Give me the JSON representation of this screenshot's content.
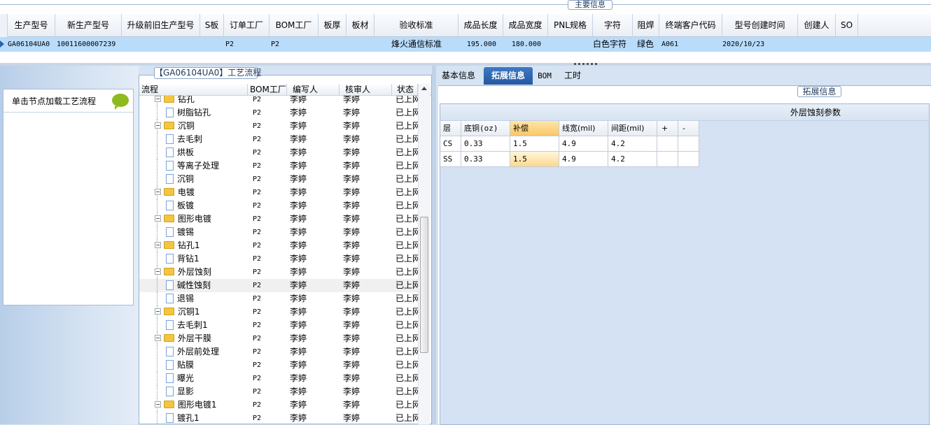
{
  "main_info": {
    "legend": "主要信息",
    "columns": [
      "生产型号",
      "新生产型号",
      "升级前旧生产型号",
      "S板",
      "订单工厂",
      "BOM工厂",
      "板厚",
      "板材",
      "验收标准",
      "成品长度",
      "成品宽度",
      "PNL规格",
      "字符",
      "阻焊",
      "终端客户代码",
      "型号创建时间",
      "创建人",
      "SO"
    ],
    "row": {
      "prod_model": "GA06104UA0",
      "new_prod_model": "10011600007239",
      "order_factory": "P2",
      "bom_factory": "P2",
      "acceptance": "烽火通信标准",
      "length": "195.000",
      "width": "180.000",
      "char": "白色字符",
      "solder": "绿色",
      "customer_code": "A061",
      "created": "2020/10/23"
    }
  },
  "left_panel": {
    "hint": "单击节点加载工艺流程"
  },
  "flow": {
    "title": "【GA06104UA0】工艺流程",
    "columns": [
      "流程",
      "BOM工厂",
      "编写人",
      "核审人",
      "状态"
    ],
    "rows": [
      {
        "name": "钻孔",
        "level": 0,
        "folder": true,
        "bom": "P2",
        "writer": "李婷",
        "reviewer": "李婷",
        "status": "已上网"
      },
      {
        "name": "树脂钻孔",
        "level": 1,
        "folder": false,
        "bom": "P2",
        "writer": "李婷",
        "reviewer": "李婷",
        "status": "已上网"
      },
      {
        "name": "沉铜",
        "level": 0,
        "folder": true,
        "bom": "P2",
        "writer": "李婷",
        "reviewer": "李婷",
        "status": "已上网"
      },
      {
        "name": "去毛刺",
        "level": 1,
        "folder": false,
        "bom": "P2",
        "writer": "李婷",
        "reviewer": "李婷",
        "status": "已上网"
      },
      {
        "name": "烘板",
        "level": 1,
        "folder": false,
        "bom": "P2",
        "writer": "李婷",
        "reviewer": "李婷",
        "status": "已上网"
      },
      {
        "name": "等离子处理",
        "level": 1,
        "folder": false,
        "bom": "P2",
        "writer": "李婷",
        "reviewer": "李婷",
        "status": "已上网"
      },
      {
        "name": "沉铜",
        "level": 1,
        "folder": false,
        "bom": "P2",
        "writer": "李婷",
        "reviewer": "李婷",
        "status": "已上网"
      },
      {
        "name": "电镀",
        "level": 0,
        "folder": true,
        "bom": "P2",
        "writer": "李婷",
        "reviewer": "李婷",
        "status": "已上网"
      },
      {
        "name": "板镀",
        "level": 1,
        "folder": false,
        "bom": "P2",
        "writer": "李婷",
        "reviewer": "李婷",
        "status": "已上网"
      },
      {
        "name": "图形电镀",
        "level": 0,
        "folder": true,
        "bom": "P2",
        "writer": "李婷",
        "reviewer": "李婷",
        "status": "已上网"
      },
      {
        "name": "镀锡",
        "level": 1,
        "folder": false,
        "bom": "P2",
        "writer": "李婷",
        "reviewer": "李婷",
        "status": "已上网"
      },
      {
        "name": "钻孔1",
        "level": 0,
        "folder": true,
        "bom": "P2",
        "writer": "李婷",
        "reviewer": "李婷",
        "status": "已上网"
      },
      {
        "name": "背钻1",
        "level": 1,
        "folder": false,
        "bom": "P2",
        "writer": "李婷",
        "reviewer": "李婷",
        "status": "已上网"
      },
      {
        "name": "外层蚀刻",
        "level": 0,
        "folder": true,
        "bom": "P2",
        "writer": "李婷",
        "reviewer": "李婷",
        "status": "已上网"
      },
      {
        "name": "碱性蚀刻",
        "level": 1,
        "folder": false,
        "bom": "P2",
        "writer": "李婷",
        "reviewer": "李婷",
        "status": "已上网",
        "selected": true
      },
      {
        "name": "退锡",
        "level": 1,
        "folder": false,
        "bom": "P2",
        "writer": "李婷",
        "reviewer": "李婷",
        "status": "已上网"
      },
      {
        "name": "沉铜1",
        "level": 0,
        "folder": true,
        "bom": "P2",
        "writer": "李婷",
        "reviewer": "李婷",
        "status": "已上网"
      },
      {
        "name": "去毛刺1",
        "level": 1,
        "folder": false,
        "bom": "P2",
        "writer": "李婷",
        "reviewer": "李婷",
        "status": "已上网"
      },
      {
        "name": "外层干膜",
        "level": 0,
        "folder": true,
        "bom": "P2",
        "writer": "李婷",
        "reviewer": "李婷",
        "status": "已上网"
      },
      {
        "name": "外层前处理",
        "level": 1,
        "folder": false,
        "bom": "P2",
        "writer": "李婷",
        "reviewer": "李婷",
        "status": "已上网"
      },
      {
        "name": "贴膜",
        "level": 1,
        "folder": false,
        "bom": "P2",
        "writer": "李婷",
        "reviewer": "李婷",
        "status": "已上网"
      },
      {
        "name": "曝光",
        "level": 1,
        "folder": false,
        "bom": "P2",
        "writer": "李婷",
        "reviewer": "李婷",
        "status": "已上网"
      },
      {
        "name": "显影",
        "level": 1,
        "folder": false,
        "bom": "P2",
        "writer": "李婷",
        "reviewer": "李婷",
        "status": "已上网"
      },
      {
        "name": "图形电镀1",
        "level": 0,
        "folder": true,
        "bom": "P2",
        "writer": "李婷",
        "reviewer": "李婷",
        "status": "已上网"
      },
      {
        "name": "镀孔1",
        "level": 1,
        "folder": false,
        "bom": "P2",
        "writer": "李婷",
        "reviewer": "李婷",
        "status": "已上网"
      }
    ]
  },
  "tabs": [
    {
      "label": "基本信息",
      "active": false
    },
    {
      "label": "拓展信息",
      "active": true
    },
    {
      "label": "BOM",
      "active": false
    },
    {
      "label": "工时",
      "active": false
    }
  ],
  "ext": {
    "legend": "拓展信息",
    "table_title": "外层蚀刻参数",
    "columns": [
      "层",
      "底铜(oz)",
      "补偿",
      "线宽(mil)",
      "间距(mil)",
      "+",
      "-"
    ],
    "rows": [
      {
        "layer": "CS",
        "base_cu": "0.33",
        "comp": "1.5",
        "line_width": "4.9",
        "spacing": "4.2"
      },
      {
        "layer": "SS",
        "base_cu": "0.33",
        "comp": "1.5",
        "line_width": "4.9",
        "spacing": "4.2"
      }
    ]
  },
  "colors": {
    "accent": "#2458a0",
    "selection": "#b9dcfb",
    "folder": "#f4c542"
  }
}
